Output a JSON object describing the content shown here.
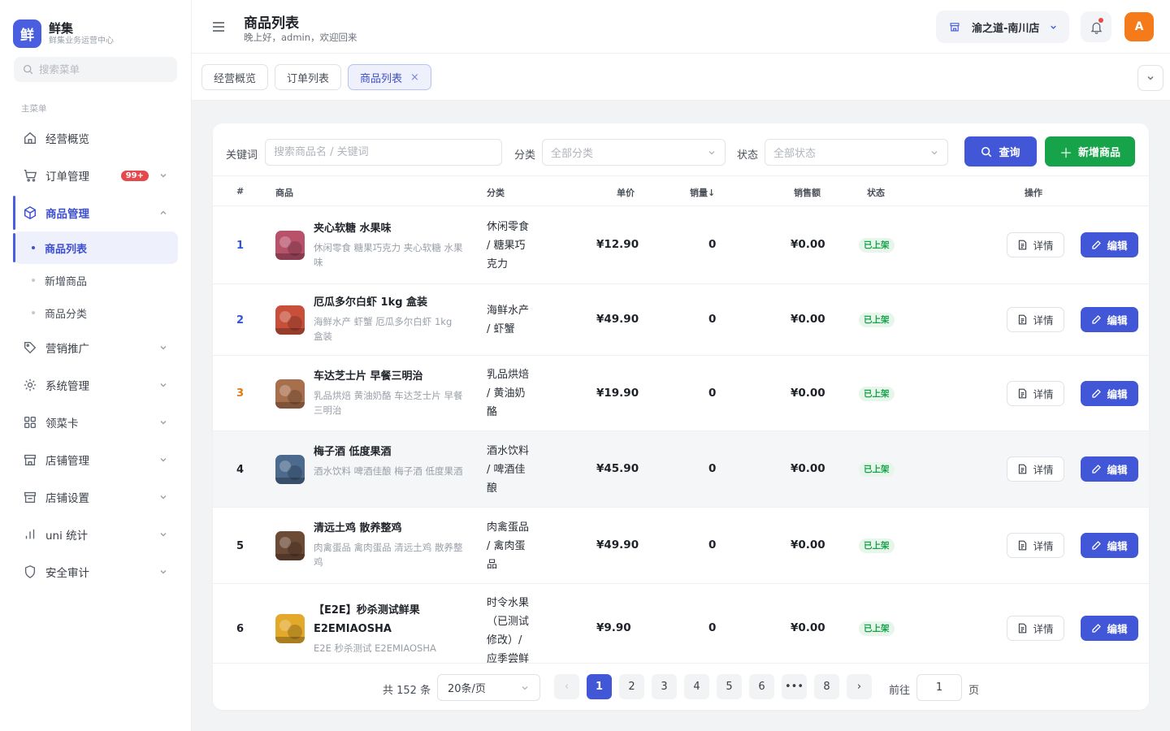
{
  "brand": {
    "logo_char": "鲜",
    "name": "鲜集",
    "subtitle": "鲜集业务运营中心"
  },
  "sidebar": {
    "search_placeholder": "搜索菜单",
    "group_label": "主菜单",
    "items": [
      {
        "label": "经营概览",
        "icon": "home-icon"
      },
      {
        "label": "订单管理",
        "icon": "cart-icon",
        "badge": "99+"
      },
      {
        "label": "商品管理",
        "icon": "cube-icon",
        "expanded": true,
        "children": [
          {
            "label": "商品列表",
            "active": true
          },
          {
            "label": "新增商品"
          },
          {
            "label": "商品分类"
          }
        ]
      },
      {
        "label": "营销推广",
        "icon": "tag-icon"
      },
      {
        "label": "系统管理",
        "icon": "gear-icon"
      },
      {
        "label": "领菜卡",
        "icon": "grid-icon"
      },
      {
        "label": "店铺管理",
        "icon": "store-icon"
      },
      {
        "label": "店铺设置",
        "icon": "store-settings-icon"
      },
      {
        "label": "uni 统计",
        "icon": "bar-chart-icon"
      },
      {
        "label": "安全审计",
        "icon": "shield-icon"
      }
    ]
  },
  "header": {
    "title": "商品列表",
    "greeting": "晚上好，admin，欢迎回来",
    "store_name": "渝之道-南川店",
    "avatar_letter": "A",
    "has_notification": true
  },
  "tabs": [
    {
      "label": "经营概览"
    },
    {
      "label": "订单列表"
    },
    {
      "label": "商品列表",
      "active": true,
      "close": "×"
    }
  ],
  "filters": {
    "keyword_label": "关键词",
    "keyword_placeholder": "搜索商品名 / 关键词",
    "category_label": "分类",
    "category_value": "全部分类",
    "status_label": "状态",
    "status_value": "全部状态",
    "query_button": "查询",
    "add_button": "新增商品"
  },
  "table": {
    "headers": {
      "index": "#",
      "product": "商品",
      "category": "分类",
      "price": "单价",
      "sales": "销量↓",
      "amount": "销售额",
      "status": "状态",
      "actions": "操作"
    },
    "detail_label": "详情",
    "edit_label": "编辑",
    "rows": [
      {
        "index": "1",
        "index_color": "#2f56d8",
        "name": "夹心软糖 水果味",
        "desc": "休闲零食 糖果巧克力 夹心软糖 水果味",
        "category": "休闲零食 / 糖果巧克力",
        "price": "¥12.90",
        "sales": "0",
        "amount": "¥0.00",
        "status": "已上架",
        "thumb_color": "#b8526b"
      },
      {
        "index": "2",
        "index_color": "#2f56d8",
        "name": "厄瓜多尔白虾 1kg 盒装",
        "desc": "海鲜水产 虾蟹 厄瓜多尔白虾 1kg 盒装",
        "category": "海鲜水产 / 虾蟹",
        "price": "¥49.90",
        "sales": "0",
        "amount": "¥0.00",
        "status": "已上架",
        "thumb_color": "#c8503a"
      },
      {
        "index": "3",
        "index_color": "#e07a12",
        "name": "车达芝士片 早餐三明治",
        "desc": "乳品烘焙 黄油奶酪 车达芝士片 早餐三明治",
        "category": "乳品烘焙 / 黄油奶酪",
        "price": "¥19.90",
        "sales": "0",
        "amount": "¥0.00",
        "status": "已上架",
        "thumb_color": "#a86f4c"
      },
      {
        "index": "4",
        "index_color": "#1f2329",
        "name": "梅子酒 低度果酒",
        "desc": "酒水饮料 啤酒佳酿 梅子酒 低度果酒",
        "category": "酒水饮料 / 啤酒佳酿",
        "price": "¥45.90",
        "sales": "0",
        "amount": "¥0.00",
        "status": "已上架",
        "thumb_color": "#4b6a8e"
      },
      {
        "index": "5",
        "index_color": "#1f2329",
        "name": "清远土鸡 散养整鸡",
        "desc": "肉禽蛋品 禽肉蛋品 清远土鸡 散养整鸡",
        "category": "肉禽蛋品 / 禽肉蛋品",
        "price": "¥49.90",
        "sales": "0",
        "amount": "¥0.00",
        "status": "已上架",
        "thumb_color": "#6b4a36"
      },
      {
        "index": "6",
        "index_color": "#1f2329",
        "name": "【E2E】秒杀测试鲜果 E2EMIAOSHA",
        "desc": "E2E 秒杀测试 E2EMIAOSHA",
        "category": "时令水果（已测试修改）/ 应季尝鲜",
        "price": "¥9.90",
        "sales": "0",
        "amount": "¥0.00",
        "status": "已上架",
        "thumb_color": "#e3a92a"
      }
    ]
  },
  "pagination": {
    "total_text": "共 152 条",
    "page_size": "20条/页",
    "prev": "‹",
    "next": "›",
    "pages": [
      "1",
      "2",
      "3",
      "4",
      "5",
      "6",
      "•••",
      "8"
    ],
    "current": "1",
    "goto_label": "前往",
    "goto_value": "1",
    "page_suffix": "页"
  }
}
